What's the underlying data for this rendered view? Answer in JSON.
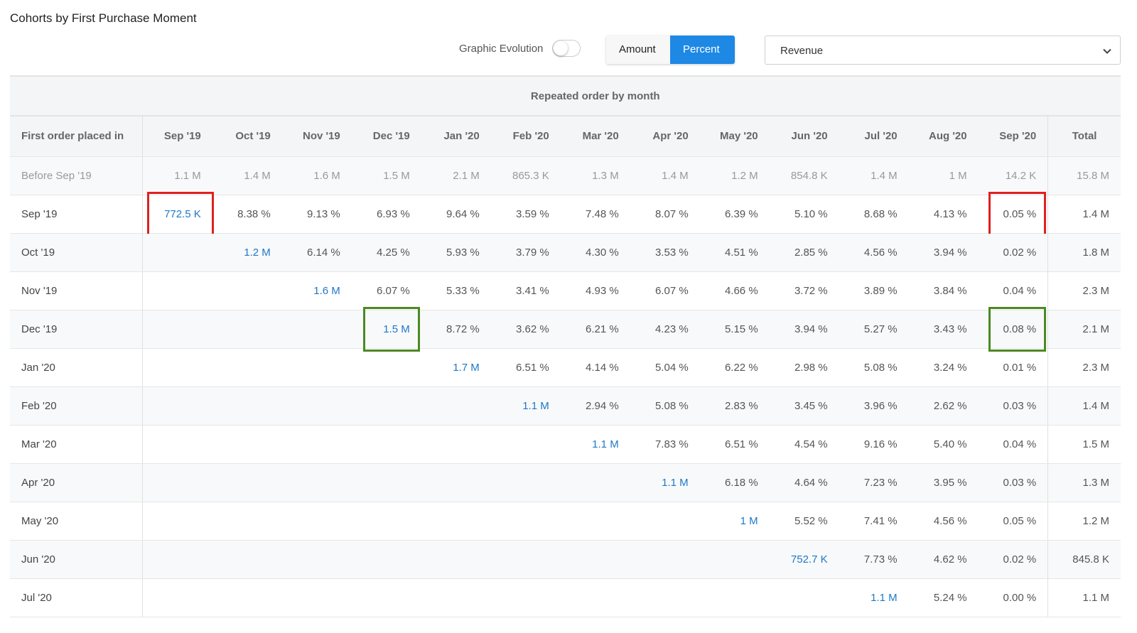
{
  "title": "Cohorts by First Purchase Moment",
  "controls": {
    "graphic_evolution_label": "Graphic Evolution",
    "graphic_evolution_on": false,
    "amount_label": "Amount",
    "percent_label": "Percent",
    "selected_mode": "Percent",
    "metric_selected": "Revenue"
  },
  "colors": {
    "accent": "#1e88e5",
    "diagonal_text": "#1e78c8",
    "highlight_red": "#e02020",
    "highlight_green": "#4a8a22"
  },
  "table": {
    "group_header": "Repeated order by month",
    "first_col_header": "First order placed in",
    "month_headers": [
      "Sep '19",
      "Oct '19",
      "Nov '19",
      "Dec '19",
      "Jan '20",
      "Feb '20",
      "Mar '20",
      "Apr '20",
      "May '20",
      "Jun '20",
      "Jul '20",
      "Aug '20",
      "Sep '20"
    ],
    "total_header": "Total",
    "rows": [
      {
        "label": "Before Sep '19",
        "cells": [
          "1.1 M",
          "1.4 M",
          "1.6 M",
          "1.5 M",
          "2.1 M",
          "865.3 K",
          "1.3 M",
          "1.4 M",
          "1.2 M",
          "854.8 K",
          "1.4 M",
          "1 M",
          "14.2 K"
        ],
        "total": "15.8 M",
        "start": -1
      },
      {
        "label": "Sep '19",
        "cells": [
          "772.5 K",
          "8.38 %",
          "9.13 %",
          "6.93 %",
          "9.64 %",
          "3.59 %",
          "7.48 %",
          "8.07 %",
          "6.39 %",
          "5.10 %",
          "8.68 %",
          "4.13 %",
          "0.05 %"
        ],
        "total": "1.4 M",
        "start": 0
      },
      {
        "label": "Oct '19",
        "cells": [
          "",
          "1.2 M",
          "6.14 %",
          "4.25 %",
          "5.93 %",
          "3.79 %",
          "4.30 %",
          "3.53 %",
          "4.51 %",
          "2.85 %",
          "4.56 %",
          "3.94 %",
          "0.02 %"
        ],
        "total": "1.8 M",
        "start": 1
      },
      {
        "label": "Nov '19",
        "cells": [
          "",
          "",
          "1.6 M",
          "6.07 %",
          "5.33 %",
          "3.41 %",
          "4.93 %",
          "6.07 %",
          "4.66 %",
          "3.72 %",
          "3.89 %",
          "3.84 %",
          "0.04 %"
        ],
        "total": "2.3 M",
        "start": 2
      },
      {
        "label": "Dec '19",
        "cells": [
          "",
          "",
          "",
          "1.5 M",
          "8.72 %",
          "3.62 %",
          "6.21 %",
          "4.23 %",
          "5.15 %",
          "3.94 %",
          "5.27 %",
          "3.43 %",
          "0.08 %"
        ],
        "total": "2.1 M",
        "start": 3
      },
      {
        "label": "Jan '20",
        "cells": [
          "",
          "",
          "",
          "",
          "1.7 M",
          "6.51 %",
          "4.14 %",
          "5.04 %",
          "6.22 %",
          "2.98 %",
          "5.08 %",
          "3.24 %",
          "0.01 %"
        ],
        "total": "2.3 M",
        "start": 4
      },
      {
        "label": "Feb '20",
        "cells": [
          "",
          "",
          "",
          "",
          "",
          "1.1 M",
          "2.94 %",
          "5.08 %",
          "2.83 %",
          "3.45 %",
          "3.96 %",
          "2.62 %",
          "0.03 %"
        ],
        "total": "1.4 M",
        "start": 5
      },
      {
        "label": "Mar '20",
        "cells": [
          "",
          "",
          "",
          "",
          "",
          "",
          "1.1 M",
          "7.83 %",
          "6.51 %",
          "4.54 %",
          "9.16 %",
          "5.40 %",
          "0.04 %"
        ],
        "total": "1.5 M",
        "start": 6
      },
      {
        "label": "Apr '20",
        "cells": [
          "",
          "",
          "",
          "",
          "",
          "",
          "",
          "1.1 M",
          "6.18 %",
          "4.64 %",
          "7.23 %",
          "3.95 %",
          "0.03 %"
        ],
        "total": "1.3 M",
        "start": 7
      },
      {
        "label": "May '20",
        "cells": [
          "",
          "",
          "",
          "",
          "",
          "",
          "",
          "",
          "1 M",
          "5.52 %",
          "7.41 %",
          "4.56 %",
          "0.05 %"
        ],
        "total": "1.2 M",
        "start": 8
      },
      {
        "label": "Jun '20",
        "cells": [
          "",
          "",
          "",
          "",
          "",
          "",
          "",
          "",
          "",
          "752.7 K",
          "7.73 %",
          "4.62 %",
          "0.02 %"
        ],
        "total": "845.8 K",
        "start": 9
      },
      {
        "label": "Jul '20",
        "cells": [
          "",
          "",
          "",
          "",
          "",
          "",
          "",
          "",
          "",
          "",
          "1.1 M",
          "5.24 %",
          "0.00 %"
        ],
        "total": "1.1 M",
        "start": 10
      }
    ],
    "highlights": [
      {
        "row": 1,
        "col": 0,
        "color": "red"
      },
      {
        "row": 1,
        "col": 12,
        "color": "red"
      },
      {
        "row": 4,
        "col": 3,
        "color": "green"
      },
      {
        "row": 4,
        "col": 12,
        "color": "green"
      }
    ]
  }
}
